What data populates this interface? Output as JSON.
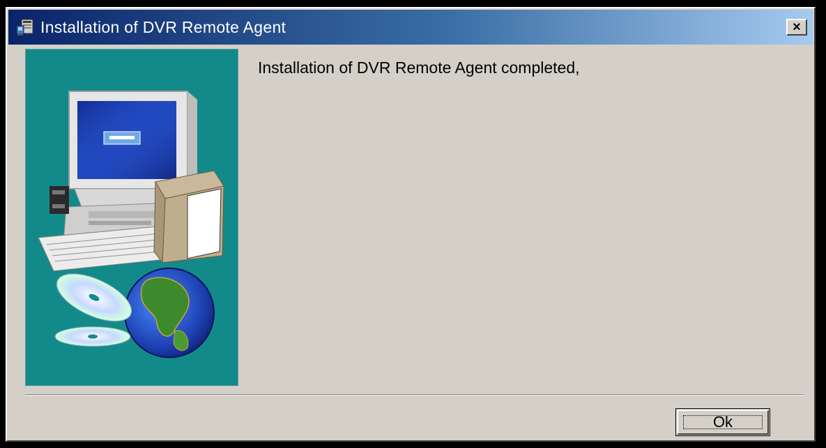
{
  "window": {
    "title": "Installation of DVR Remote Agent",
    "close_label": "×",
    "app_icon": "installer-icon"
  },
  "side_image": {
    "description_icons": [
      "computer-icon",
      "box-icon",
      "cd-icon",
      "globe-icon"
    ],
    "background_color": "#138a8a"
  },
  "message": {
    "text": "Installation of DVR Remote Agent completed,"
  },
  "buttons": {
    "ok_label": "Ok"
  }
}
